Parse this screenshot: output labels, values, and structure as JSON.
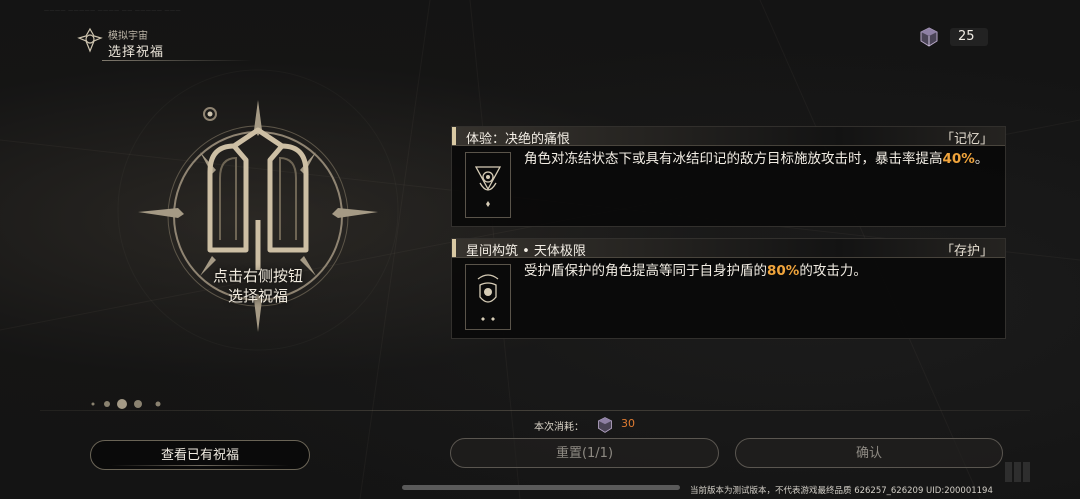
{
  "header": {
    "subtitle": "模拟宇宙",
    "title": "选择祝福"
  },
  "currency": {
    "icon": "cube-icon",
    "value": "25"
  },
  "emblem": {
    "line1": "点击右侧按钮",
    "line2": "选择祝福"
  },
  "blessings": [
    {
      "title": "体验：决绝的痛恨",
      "path": "「记忆」",
      "icon": "memory-blessing-icon",
      "desc_parts": [
        "角色对冻结状态下或具有冰结印记的敌方目标施放攻击时，暴击率提高",
        "40%",
        "。"
      ]
    },
    {
      "title": "星间构筑 • 天体极限",
      "path": "「存护」",
      "icon": "preservation-blessing-icon",
      "desc_parts": [
        "受护盾保护的角色提高等同于自身护盾的",
        "80%",
        "的攻击力。"
      ]
    }
  ],
  "cost": {
    "label": "本次消耗：",
    "value": "30"
  },
  "buttons": {
    "owned": "查看已有祝福",
    "reset": "重置(1/1)",
    "confirm": "确认"
  },
  "footer": "当前版本为测试版本，不代表游戏最终品质  626257_626209  UID:200001194",
  "colors": {
    "highlight": "#f0a43c",
    "cost": "#e07c32",
    "accent": "#d9c9a3"
  }
}
